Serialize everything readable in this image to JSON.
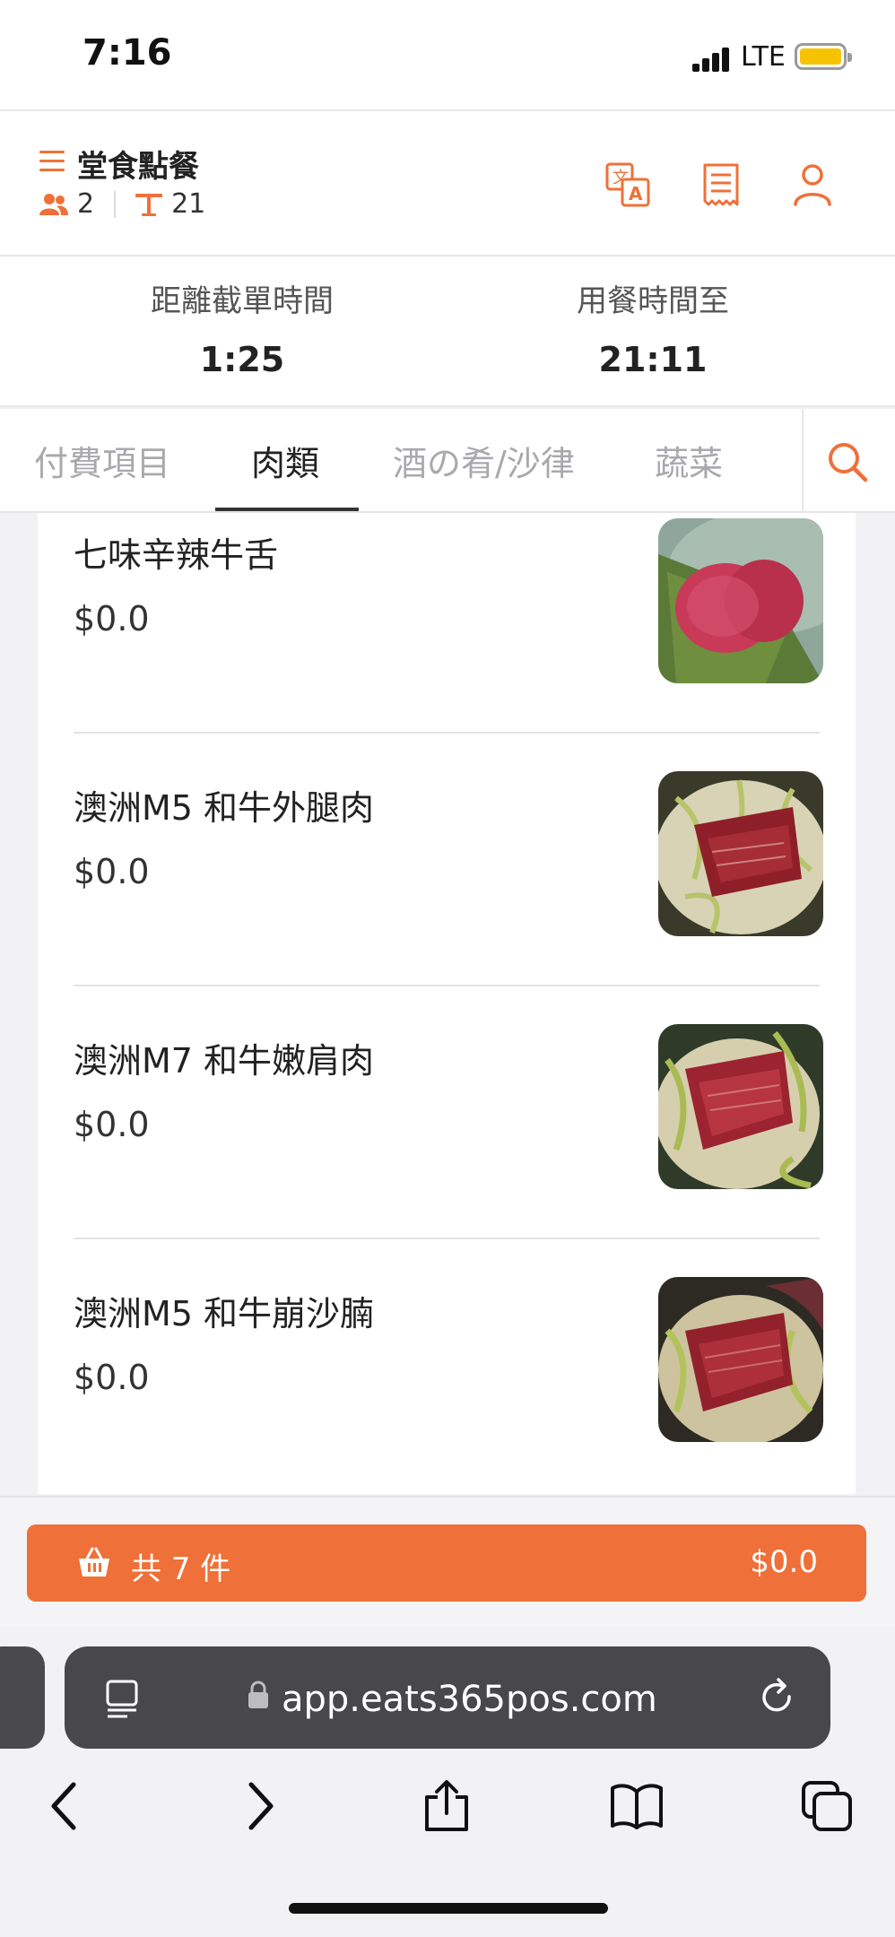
{
  "status_bar": {
    "time": "7:16",
    "network": "LTE"
  },
  "header": {
    "title": "堂食點餐",
    "guests": "2",
    "table": "21",
    "icons": [
      "hamburger-menu-icon",
      "translate-icon",
      "receipt-icon",
      "user-icon"
    ],
    "accent_color": "#ef7038"
  },
  "timers": {
    "cutoff_label": "距離截單時間",
    "cutoff_value": "1:25",
    "dining_label": "用餐時間至",
    "dining_value": "21:11"
  },
  "tabs": [
    {
      "label": "付費項目",
      "active": false
    },
    {
      "label": "肉類",
      "active": true
    },
    {
      "label": "酒の肴/沙律",
      "active": false
    },
    {
      "label": "蔬菜",
      "active": false
    }
  ],
  "items": [
    {
      "name": "七味辛辣牛舌",
      "price": "$0.0"
    },
    {
      "name": "澳洲M5 和牛外腿肉",
      "price": "$0.0"
    },
    {
      "name": "澳洲M7 和牛嫩肩肉",
      "price": "$0.0"
    },
    {
      "name": "澳洲M5 和牛崩沙腩",
      "price": "$0.0"
    }
  ],
  "cart": {
    "count_label": "共 7 件",
    "total": "$0.0"
  },
  "browser": {
    "url": "app.eats365pos.com"
  }
}
